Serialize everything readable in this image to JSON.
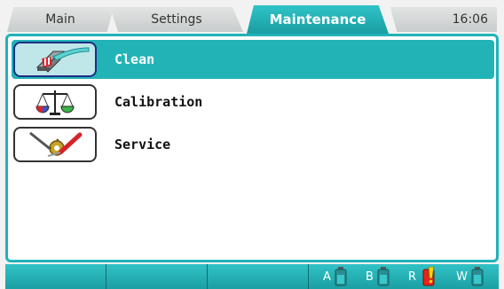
{
  "tabs": {
    "main": "Main",
    "settings": "Settings",
    "maintenance": "Maintenance",
    "clock": "16:06"
  },
  "menu": [
    {
      "label": "Clean",
      "icon": "clean-brush-icon",
      "selected": true
    },
    {
      "label": "Calibration",
      "icon": "balance-scale-icon",
      "selected": false
    },
    {
      "label": "Service",
      "icon": "tools-gear-icon",
      "selected": false
    }
  ],
  "status": {
    "bottles": [
      {
        "letter": "A",
        "state": "ok"
      },
      {
        "letter": "B",
        "state": "ok"
      },
      {
        "letter": "R",
        "state": "warning"
      },
      {
        "letter": "W",
        "state": "ok"
      }
    ]
  },
  "colors": {
    "accent": "#22b3b7",
    "selected_border": "#1d2f86",
    "warning": "#e8231d",
    "warning_mark": "#f5d800"
  }
}
